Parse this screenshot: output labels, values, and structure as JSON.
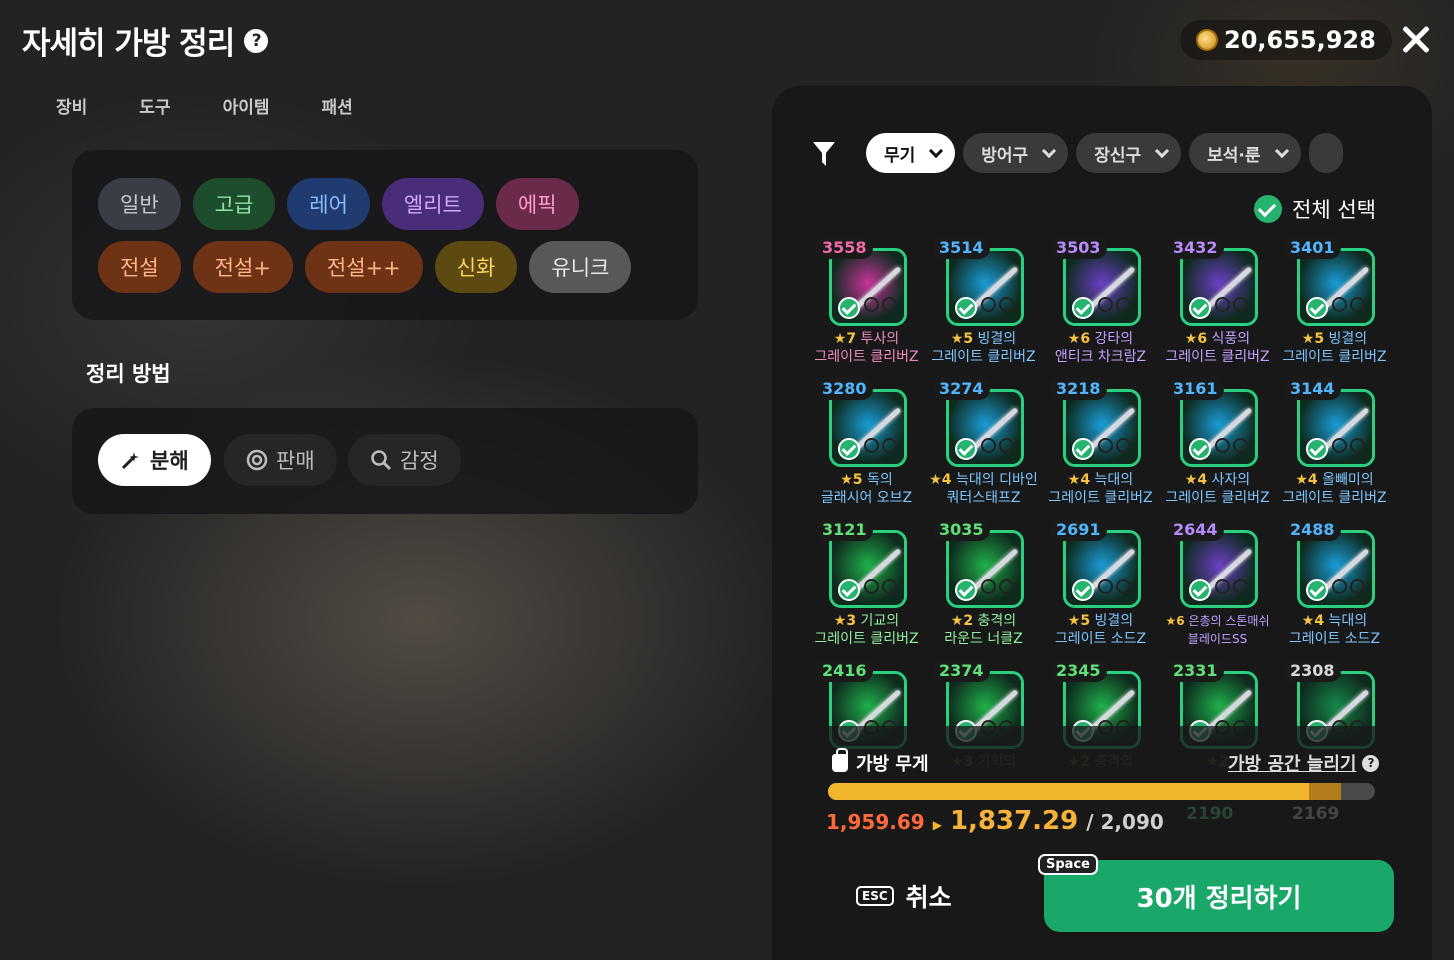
{
  "header": {
    "title": "자세히 가방 정리",
    "help_icon": "?",
    "gold": "20,655,928"
  },
  "tabs": [
    {
      "label": "장비",
      "active": true
    },
    {
      "label": "도구",
      "active": false
    },
    {
      "label": "아이템",
      "active": false
    },
    {
      "label": "패션",
      "active": false
    }
  ],
  "grades": [
    {
      "label": "일반",
      "bg": "#3a3d45",
      "fg": "#c7c9cf"
    },
    {
      "label": "고급",
      "bg": "#1e4d2e",
      "fg": "#8fe3a3"
    },
    {
      "label": "레어",
      "bg": "#1f3b70",
      "fg": "#8fb8ff"
    },
    {
      "label": "엘리트",
      "bg": "#4a2d7a",
      "fg": "#d0a6ff"
    },
    {
      "label": "에픽",
      "bg": "#6a2a4a",
      "fg": "#ff9ac8"
    },
    {
      "label": "전설",
      "bg": "#6e3214",
      "fg": "#ffb58a"
    },
    {
      "label": "전설+",
      "bg": "#6e3214",
      "fg": "#ffb58a"
    },
    {
      "label": "전설++",
      "bg": "#6e3214",
      "fg": "#ffb58a"
    },
    {
      "label": "신화",
      "bg": "#5c4a12",
      "fg": "#ffd35c"
    },
    {
      "label": "유니크",
      "bg": "#58575a",
      "fg": "#e8e8e8"
    }
  ],
  "sort": {
    "label": "정리 방법",
    "options": [
      {
        "label": "분해",
        "icon": "disassemble-icon",
        "active": true
      },
      {
        "label": "판매",
        "icon": "coin-sell-icon",
        "active": false
      },
      {
        "label": "감정",
        "icon": "search-icon",
        "active": false
      }
    ]
  },
  "filters": [
    {
      "label": "무기",
      "active": true
    },
    {
      "label": "방어구",
      "active": false
    },
    {
      "label": "장신구",
      "active": false
    },
    {
      "label": "보석·룬",
      "active": false
    }
  ],
  "select_all_label": "전체 선택",
  "items": [
    {
      "score": "3558",
      "score_color": "#f06aa8",
      "stars": "★7",
      "name1": "투사의",
      "name2": "그레이트 클리버Z",
      "name_color": "#f08ac0",
      "glow": "#c7349a"
    },
    {
      "score": "3514",
      "score_color": "#4fb6ff",
      "stars": "★5",
      "name1": "빙결의",
      "name2": "그레이트 클리버Z",
      "name_color": "#7ec6ff",
      "glow": "#1a9cd6"
    },
    {
      "score": "3503",
      "score_color": "#b88cff",
      "stars": "★6",
      "name1": "강타의",
      "name2": "앤티크 차크람Z",
      "name_color": "#c2a0ff",
      "glow": "#6b3fc4"
    },
    {
      "score": "3432",
      "score_color": "#b88cff",
      "stars": "★6",
      "name1": "식풍의",
      "name2": "그레이트 클리버Z",
      "name_color": "#c2a0ff",
      "glow": "#6b3fc4"
    },
    {
      "score": "3401",
      "score_color": "#4fb6ff",
      "stars": "★5",
      "name1": "빙결의",
      "name2": "그레이트 클리버Z",
      "name_color": "#7ec6ff",
      "glow": "#1a9cd6"
    },
    {
      "score": "3280",
      "score_color": "#4fb6ff",
      "stars": "★5",
      "name1": "독의",
      "name2": "글래시어 오브Z",
      "name_color": "#7ec6ff",
      "glow": "#1a9cd6"
    },
    {
      "score": "3274",
      "score_color": "#4fb6ff",
      "stars": "★4",
      "name1": "늑대의 디바인",
      "name2": "쿼터스태프Z",
      "name_color": "#7ec6ff",
      "glow": "#1a9cd6"
    },
    {
      "score": "3218",
      "score_color": "#4fb6ff",
      "stars": "★4",
      "name1": "늑대의",
      "name2": "그레이트 클리버Z",
      "name_color": "#7ec6ff",
      "glow": "#1a9cd6"
    },
    {
      "score": "3161",
      "score_color": "#4fb6ff",
      "stars": "★4",
      "name1": "사자의",
      "name2": "그레이트 클리버Z",
      "name_color": "#7ec6ff",
      "glow": "#1a9cd6"
    },
    {
      "score": "3144",
      "score_color": "#4fb6ff",
      "stars": "★4",
      "name1": "올빼미의",
      "name2": "그레이트 클리버Z",
      "name_color": "#7ec6ff",
      "glow": "#1a9cd6"
    },
    {
      "score": "3121",
      "score_color": "#5fe07a",
      "stars": "★3",
      "name1": "기교의",
      "name2": "그레이트 클리버Z",
      "name_color": "#8ef0a0",
      "glow": "#1fb04a"
    },
    {
      "score": "3035",
      "score_color": "#5fe07a",
      "stars": "★2",
      "name1": "충격의",
      "name2": "라운드 너클Z",
      "name_color": "#8ef0a0",
      "glow": "#1fb04a"
    },
    {
      "score": "2691",
      "score_color": "#4fb6ff",
      "stars": "★5",
      "name1": "빙결의",
      "name2": "그레이트 소드Z",
      "name_color": "#7ec6ff",
      "glow": "#1a9cd6"
    },
    {
      "score": "2644",
      "score_color": "#b88cff",
      "stars": "★6",
      "name1": "은총의 스톤매쉬",
      "name2": "블레이드SS",
      "name_color": "#c2a0ff",
      "glow": "#6b3fc4"
    },
    {
      "score": "2488",
      "score_color": "#4fb6ff",
      "stars": "★4",
      "name1": "늑대의",
      "name2": "그레이트 소드Z",
      "name_color": "#7ec6ff",
      "glow": "#1a9cd6"
    },
    {
      "score": "2416",
      "score_color": "#5fe07a",
      "stars": "★2",
      "name1": "",
      "name2": "",
      "name_color": "#8ef0a0",
      "glow": "#1fb04a"
    },
    {
      "score": "2374",
      "score_color": "#5fe07a",
      "stars": "★3",
      "name1": "기회의",
      "name2": "",
      "name_color": "#8ef0a0",
      "glow": "#1fb04a"
    },
    {
      "score": "2345",
      "score_color": "#5fe07a",
      "stars": "★2",
      "name1": "충격의",
      "name2": "",
      "name_color": "#8ef0a0",
      "glow": "#1fb04a"
    },
    {
      "score": "2331",
      "score_color": "#5fe07a",
      "stars": "★2",
      "name1": "",
      "name2": "",
      "name_color": "#8ef0a0",
      "glow": "#1fb04a"
    },
    {
      "score": "2308",
      "score_color": "#d8d8d8",
      "stars": "",
      "name1": "",
      "name2": "",
      "name_color": "#cfcfcf",
      "glow": "#16884a"
    }
  ],
  "partial_scores": [
    "2190",
    "2169"
  ],
  "weight": {
    "label": "가방 무게",
    "before": "1,959.69",
    "after": "1,837.29",
    "max": "/ 2,090",
    "after_fraction": 0.879,
    "before_fraction": 0.937
  },
  "expand_label": "가방 공간 늘리기",
  "cancel": {
    "key": "ESC",
    "label": "취소"
  },
  "confirm": {
    "key": "Space",
    "label": "30개 정리하기"
  }
}
